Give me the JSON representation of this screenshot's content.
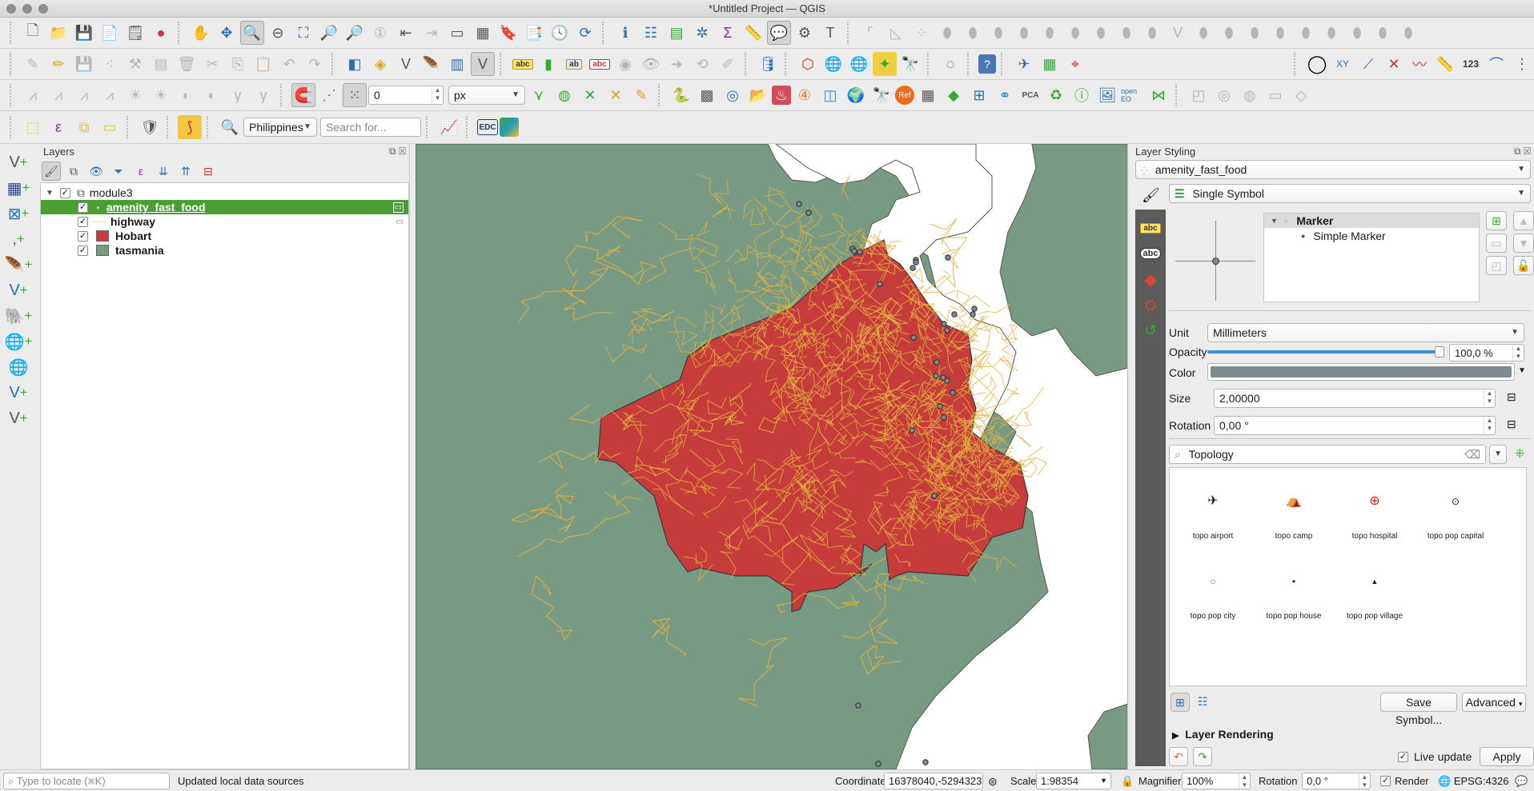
{
  "window": {
    "title": "*Untitled Project — QGIS"
  },
  "toolbars": {
    "snapping_tolerance": "0",
    "snapping_unit": "px",
    "locator_region": "Philippines",
    "search_placeholder": "Search for...",
    "edc_label": "EDC",
    "open_eo_label": "open EO",
    "pca_label": "PCA",
    "ref_label": "Ref",
    "label_123": "123",
    "xy_label": "XY"
  },
  "layers_panel": {
    "title": "Layers",
    "group": {
      "name": "module3",
      "checked": true
    },
    "layers": [
      {
        "name": "amenity_fast_food",
        "checked": true,
        "selected": true,
        "type": "point"
      },
      {
        "name": "highway",
        "checked": true,
        "selected": false,
        "type": "line",
        "color": "#e8c05a"
      },
      {
        "name": "Hobart",
        "checked": true,
        "selected": false,
        "type": "polygon",
        "color": "#c63c3b"
      },
      {
        "name": "tasmania",
        "checked": true,
        "selected": false,
        "type": "polygon",
        "color": "#789a82"
      }
    ]
  },
  "layer_styling": {
    "title": "Layer Styling",
    "layer": "amenity_fast_food",
    "renderer": "Single Symbol",
    "symbol_tree": {
      "root": "Marker",
      "child": "Simple Marker"
    },
    "unit_label": "Unit",
    "unit": "Millimeters",
    "opacity_label": "Opacity",
    "opacity": "100,0 %",
    "opacity_fraction": 1.0,
    "color_label": "Color",
    "color": "#7e8b8f",
    "size_label": "Size",
    "size": "2,00000",
    "rotation_label": "Rotation",
    "rotation": "0,00 °",
    "symbol_search": "Topology",
    "symbols": [
      {
        "name": "topo airport",
        "glyph": "✈"
      },
      {
        "name": "topo camp",
        "glyph": "⛺"
      },
      {
        "name": "topo hospital",
        "glyph": "⊕"
      },
      {
        "name": "topo pop capital",
        "glyph": "⊙"
      },
      {
        "name": "topo pop city",
        "glyph": "○"
      },
      {
        "name": "topo pop house",
        "glyph": "•"
      },
      {
        "name": "topo pop village",
        "glyph": "▲"
      }
    ],
    "save_symbol": "Save Symbol...",
    "advanced": "Advanced",
    "layer_rendering": "Layer Rendering",
    "live_update": "Live update",
    "live_update_checked": true,
    "apply": "Apply"
  },
  "statusbar": {
    "locate_placeholder": "Type to locate (⌘K)",
    "message": "Updated local data sources",
    "coordinate_label": "Coordinate",
    "coordinate": "16378040,-5294323",
    "scale_label": "Scale",
    "scale": "1:98354",
    "magnifier_label": "Magnifier",
    "magnifier": "100%",
    "rotation_label": "Rotation",
    "rotation": "0,0 °",
    "render_label": "Render",
    "render_checked": true,
    "crs": "EPSG:4326"
  },
  "map_colors": {
    "land": "#789a82",
    "hobart": "#c63c3b",
    "roads": "#e2b33f",
    "water": "#ffffff",
    "points": "#7e8b8f"
  }
}
